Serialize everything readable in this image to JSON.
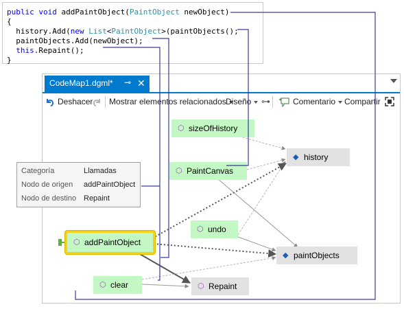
{
  "code": {
    "line1": {
      "kw1": "public",
      "kw2": "void",
      "name": "addPaintObject(",
      "type": "PaintObject",
      "param": " newObject)"
    },
    "line2": "{",
    "line3": {
      "pre": "  history.Add(",
      "kw": "new",
      "sp": " ",
      "type1": "List",
      "lt": "<",
      "type2": "PaintObject",
      "post": ">(paintObjects();"
    },
    "line4": "  paintObjects.Add(newObject);",
    "line5": {
      "pre": "  ",
      "kw": "this",
      "post": ".Repaint();"
    },
    "line6": "}"
  },
  "window": {
    "tab_title": "CodeMap1.dgml*",
    "pin_glyph": "⊸",
    "close_glyph": "✕"
  },
  "toolbar": {
    "undo_label": "Deshacer",
    "show_related_label": "Mostrar elementos relacionados",
    "layout_label": "Diseño",
    "comment_label": "Comentario",
    "share_label": "Compartir"
  },
  "nodes": {
    "size_of_history": "sizeOfHistory",
    "paint_canvas": "PaintCanvas",
    "undo": "undo",
    "add_paint_object": "addPaintObject",
    "clear": "clear",
    "history": "history",
    "paint_objects": "paintObjects",
    "repaint": "Repaint"
  },
  "tooltip": {
    "category_key": "Categoría",
    "category_value": "Llamadas",
    "source_key": "Nodo de origen",
    "source_value": "addPaintObject",
    "target_key": "Nodo de destino",
    "target_value": "Repaint"
  },
  "colors": {
    "accent": "#007acc",
    "method_node": "#c3f7c3",
    "field_node": "#e2e2e2",
    "selection": "#f5d11a",
    "code_link": "#3a3aa0"
  }
}
